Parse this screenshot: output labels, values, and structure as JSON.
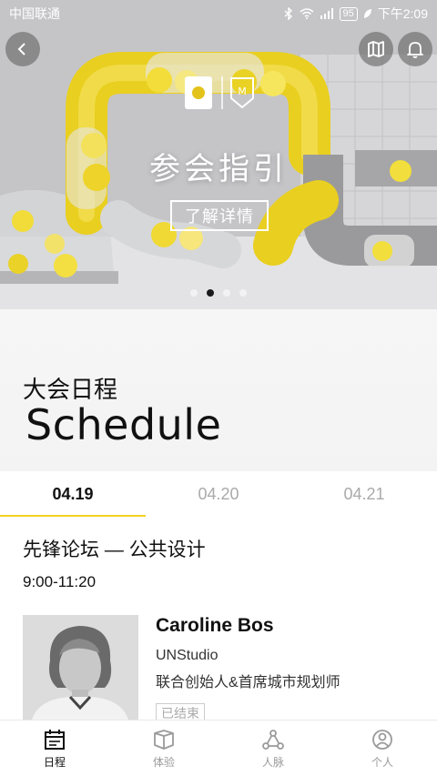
{
  "status_bar": {
    "carrier": "中国联通",
    "battery": "95",
    "time": "下午2:09"
  },
  "hero": {
    "title": "参会指引",
    "cta_label": "了解详情",
    "logo_letter": "M",
    "slides_count": 4,
    "active_slide": 2,
    "accent_color": "#f4d21f"
  },
  "schedule_header": {
    "title_cn": "大会日程",
    "title_en": "Schedule"
  },
  "date_tabs": [
    {
      "label": "04.19",
      "active": true
    },
    {
      "label": "04.20",
      "active": false
    },
    {
      "label": "04.21",
      "active": false
    }
  ],
  "session": {
    "title": "先锋论坛 — 公共设计",
    "time": "9:00-11:20",
    "speaker": {
      "name": "Caroline Bos",
      "organization": "UNStudio",
      "role": "联合创始人&首席城市规划师",
      "status": "已结束"
    }
  },
  "bottom_nav": [
    {
      "label": "日程",
      "icon": "calendar-icon",
      "active": true
    },
    {
      "label": "体验",
      "icon": "box-icon",
      "active": false
    },
    {
      "label": "人脉",
      "icon": "network-icon",
      "active": false
    },
    {
      "label": "个人",
      "icon": "user-icon",
      "active": false
    }
  ]
}
